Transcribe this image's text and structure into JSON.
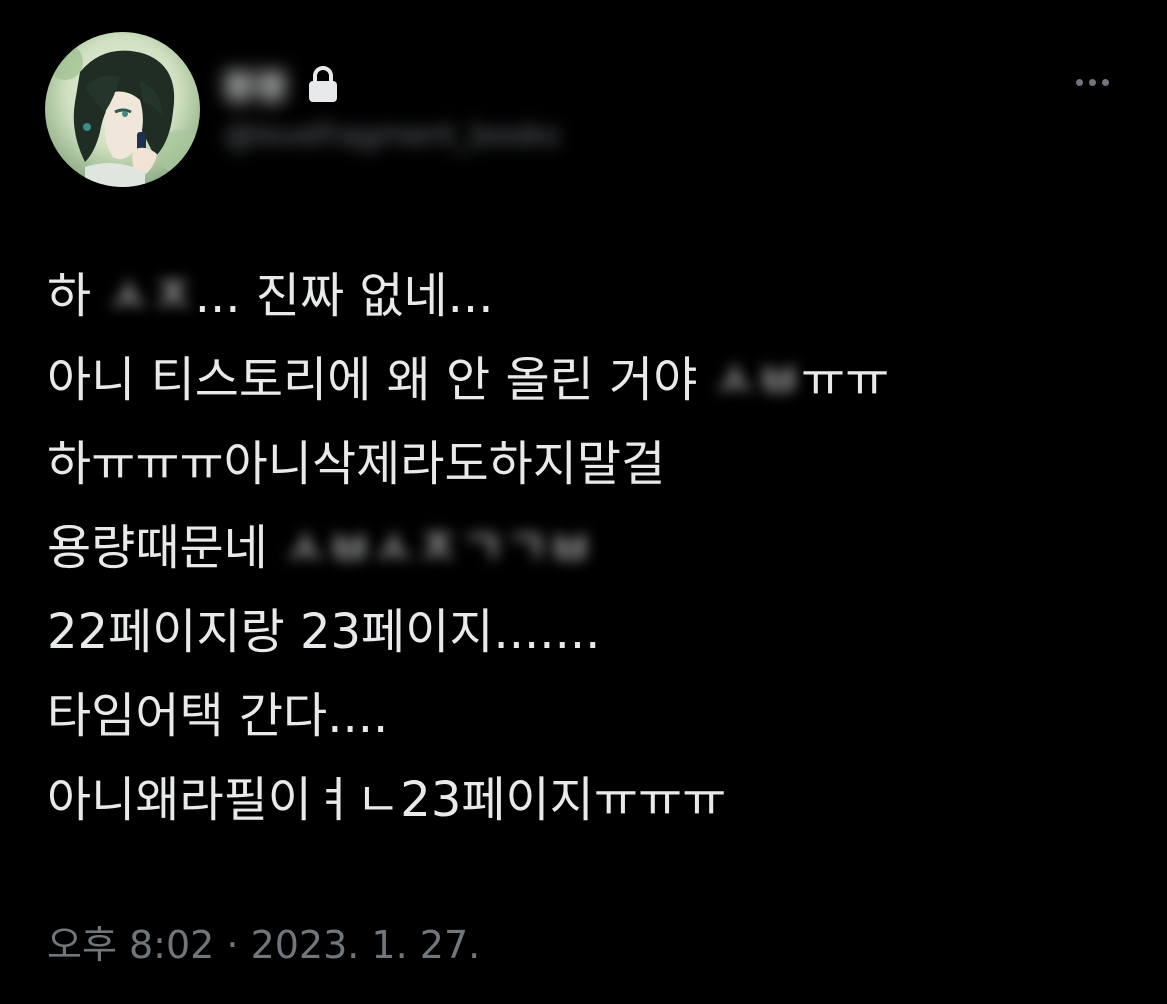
{
  "author": {
    "display_name": "봉봉",
    "handle": "@lovefragment_books",
    "protected_icon": "lock-icon",
    "avatar_icon": "avatar-illustration"
  },
  "more_icon": "more-horizontal-icon",
  "tweet": {
    "lines": [
      {
        "before": "하 ",
        "blurred": "ㅅㅈ",
        "after": "... 진짜 없네..."
      },
      {
        "before": "아니 티스토리에 왜 안 올린 거야 ",
        "blurred": "ㅅㅂ",
        "after": "ㅠㅠ"
      },
      {
        "before": "하ㅠㅠㅠ아니삭제라도하지말걸",
        "blurred": "",
        "after": ""
      },
      {
        "before": "용량때문네 ",
        "blurred": "ㅅㅂㅅㅈㄱㄱㅂ",
        "after": ""
      },
      {
        "before": "22페이지랑 23페이지.......",
        "blurred": "",
        "after": ""
      },
      {
        "before": "타임어택 간다....",
        "blurred": "",
        "after": ""
      },
      {
        "before": "아니왜라필이ㅕㄴ23페이지ㅠㅠㅠ",
        "blurred": "",
        "after": ""
      }
    ]
  },
  "timestamp": "오후 8:02 · 2023. 1. 27.",
  "colors": {
    "background": "#000000",
    "text": "#e7e9ea",
    "secondary": "#71767b"
  }
}
